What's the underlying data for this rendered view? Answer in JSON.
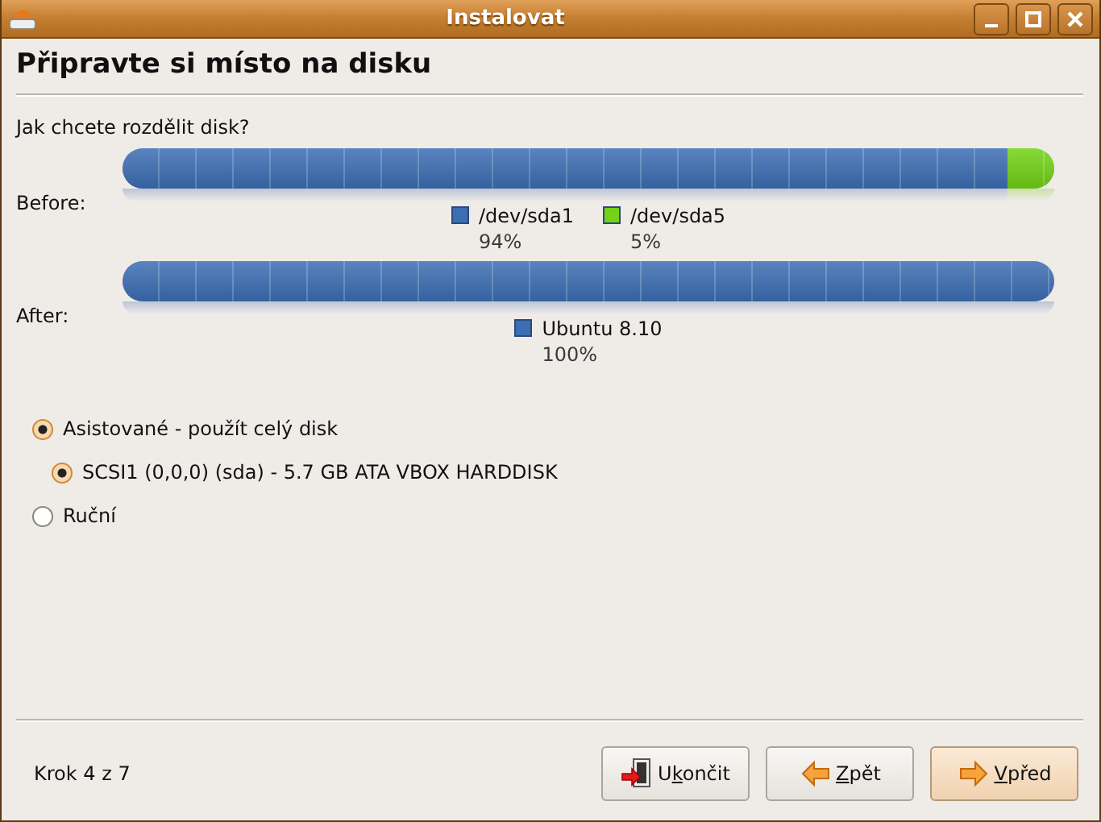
{
  "window": {
    "title": "Instalovat"
  },
  "heading": "Připravte si místo na disku",
  "question": "Jak chcete rozdělit disk?",
  "bars": [
    {
      "label": "Before:",
      "segments": [
        {
          "level": 0.95,
          "color": "#3c6eb4"
        },
        {
          "level": 0.05,
          "color": "#73d216"
        }
      ],
      "legend": [
        {
          "name": "/dev/sda1",
          "percent": "94%",
          "color": "#3c6eb4"
        },
        {
          "name": "/dev/sda5",
          "percent": "5%",
          "color": "#73d216"
        }
      ]
    },
    {
      "label": "After:",
      "segments": [
        {
          "level": 1,
          "color": "#3c6eb4"
        }
      ],
      "legend": [
        {
          "name": "Ubuntu 8.10",
          "percent": "100%",
          "color": "#3c6eb4"
        }
      ]
    }
  ],
  "options": [
    {
      "label": "Asistované - použít celý disk",
      "selected": true,
      "children": [
        {
          "label": "SCSI1 (0,0,0) (sda) - 5.7 GB ATA VBOX HARDDISK",
          "selected": true
        }
      ]
    },
    {
      "label": "Ruční",
      "selected": false
    }
  ],
  "step": "Krok 4 z 7",
  "buttons": [
    {
      "kind": "quit",
      "before": "U",
      "key": "k",
      "after": "ončit",
      "default": false
    },
    {
      "kind": "back",
      "key": "Z",
      "after": "pět",
      "default": false
    },
    {
      "kind": "forward",
      "key": "V",
      "after": "před",
      "default": true
    }
  ]
}
